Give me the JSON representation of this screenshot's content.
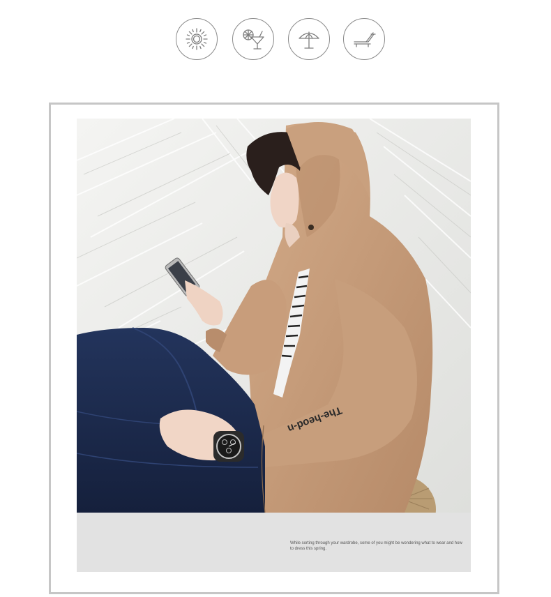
{
  "icons": [
    {
      "name": "sun-icon"
    },
    {
      "name": "cocktail-icon"
    },
    {
      "name": "beach-umbrella-icon"
    },
    {
      "name": "sun-lounger-icon"
    }
  ],
  "photo": {
    "sleeve_print": "The-heod-n"
  },
  "caption": {
    "text": "While sorting through your wardrobe, some of you might be wondering what to wear and how to dress this spring."
  },
  "colors": {
    "jacket": "#c9a07e",
    "denim": "#1c2a4e",
    "caption_bg": "#e2e2e2",
    "frame": "#c6c6c6"
  }
}
